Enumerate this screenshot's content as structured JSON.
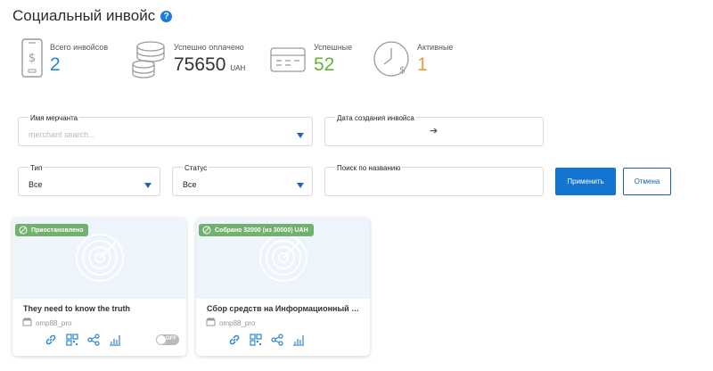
{
  "page": {
    "title": "Социальный инвойс",
    "help_icon": "?"
  },
  "colors": {
    "accent": "#1474d2",
    "blue": "#2a86d6",
    "green": "#61b434",
    "orange": "#e8a23a",
    "badge_green": "#72b06e"
  },
  "stats": [
    {
      "label": "Всего инвойсов",
      "value": "2",
      "icon": "phone-dollar-icon"
    },
    {
      "label": "Успешно оплачено",
      "value": "75650",
      "unit": "UAH",
      "icon": "coins-stack-icon"
    },
    {
      "label": "Успешные",
      "value": "52",
      "icon": "cash-register-icon"
    },
    {
      "label": "Активные",
      "value": "1",
      "icon": "clock-dollar-icon"
    }
  ],
  "filters": {
    "merchant": {
      "label": "Имя мерчанта",
      "placeholder": "merchant search..."
    },
    "created": {
      "label": "Дата создания инвойса",
      "arrow": "➔"
    },
    "type": {
      "label": "Тип",
      "value": "Все"
    },
    "status": {
      "label": "Статус",
      "value": "Все"
    },
    "search": {
      "label": "Поиск по названию",
      "value": ""
    },
    "apply_label": "Применить",
    "cancel_label": "Отмена"
  },
  "cards": [
    {
      "badge": "Приостановлено",
      "title": "They need to know the truth",
      "merchant": "omp88_pro",
      "toggle_label": "OFF"
    },
    {
      "badge": "Собрано 32000 (из 30000) UAH",
      "title": "Сбор средств на Информационный Ф...",
      "merchant": "omp88_pro"
    }
  ]
}
